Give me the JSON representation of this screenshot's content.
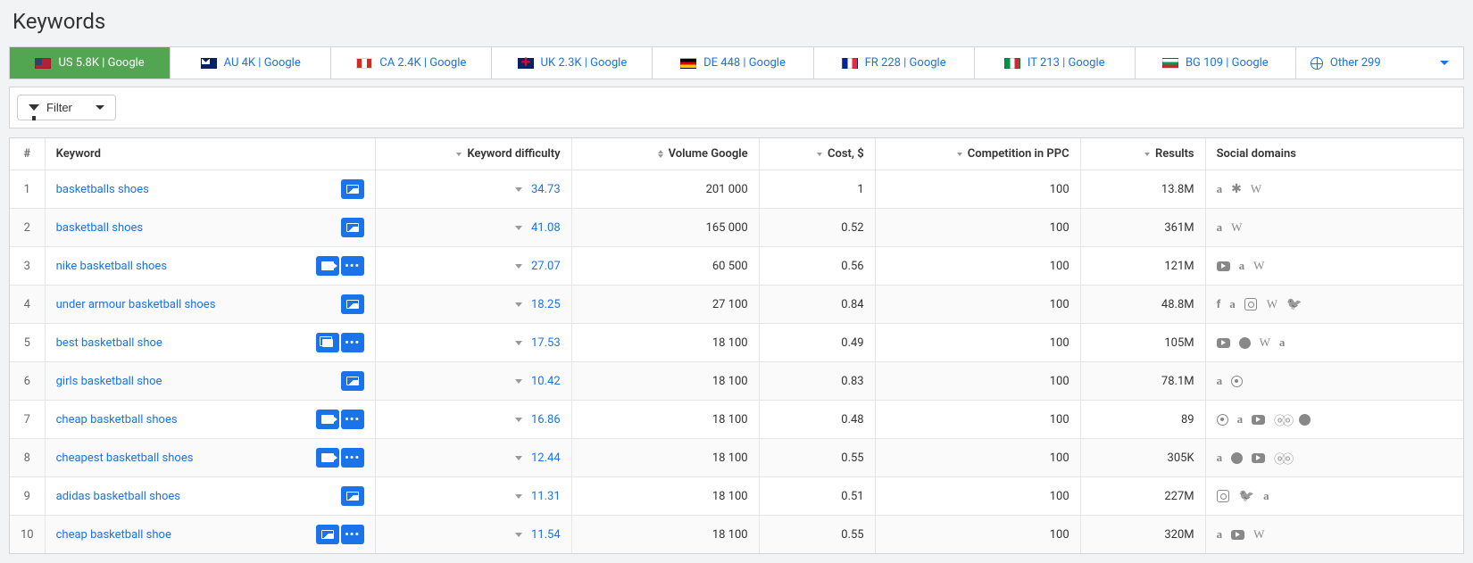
{
  "page_title": "Keywords",
  "filter_button_label": "Filter",
  "tabs": [
    {
      "label": "US 5.8K | Google",
      "flag": "us",
      "active": true
    },
    {
      "label": "AU 4K | Google",
      "flag": "au",
      "active": false
    },
    {
      "label": "CA 2.4K | Google",
      "flag": "ca",
      "active": false
    },
    {
      "label": "UK 2.3K | Google",
      "flag": "uk",
      "active": false
    },
    {
      "label": "DE 448 | Google",
      "flag": "de",
      "active": false
    },
    {
      "label": "FR 228 | Google",
      "flag": "fr",
      "active": false
    },
    {
      "label": "IT 213 | Google",
      "flag": "it",
      "active": false
    },
    {
      "label": "BG 109 | Google",
      "flag": "bg",
      "active": false
    },
    {
      "label": "Other 299",
      "flag": "globe",
      "active": false,
      "dropdown": true
    }
  ],
  "columns": {
    "num": "#",
    "keyword": "Keyword",
    "kd": "Keyword difficulty",
    "volume": "Volume Google",
    "cost": "Cost, $",
    "competition": "Competition in PPC",
    "results": "Results",
    "social": "Social domains"
  },
  "rows": [
    {
      "n": "1",
      "keyword": "basketballs shoes",
      "actions": [
        "image"
      ],
      "kd": "34.73",
      "volume": "201 000",
      "cost": "1",
      "competition": "100",
      "results": "13.8M",
      "social": [
        "amazon",
        "yelp",
        "wikipedia"
      ]
    },
    {
      "n": "2",
      "keyword": "basketball shoes",
      "actions": [
        "image"
      ],
      "kd": "41.08",
      "volume": "165 000",
      "cost": "0.52",
      "competition": "100",
      "results": "361M",
      "social": [
        "amazon",
        "wikipedia"
      ]
    },
    {
      "n": "3",
      "keyword": "nike basketball shoes",
      "actions": [
        "video",
        "more"
      ],
      "kd": "27.07",
      "volume": "60 500",
      "cost": "0.56",
      "competition": "100",
      "results": "121M",
      "social": [
        "youtube",
        "amazon",
        "wikipedia"
      ]
    },
    {
      "n": "4",
      "keyword": "under armour basketball shoes",
      "actions": [
        "image"
      ],
      "kd": "18.25",
      "volume": "27 100",
      "cost": "0.84",
      "competition": "100",
      "results": "48.8M",
      "social": [
        "facebook",
        "amazon",
        "instagram",
        "wikipedia",
        "twitter"
      ]
    },
    {
      "n": "5",
      "keyword": "best basketball shoe",
      "actions": [
        "cards",
        "more"
      ],
      "kd": "17.53",
      "volume": "18 100",
      "cost": "0.49",
      "competition": "100",
      "results": "105M",
      "social": [
        "youtube",
        "reddit",
        "wikipedia",
        "amazon"
      ]
    },
    {
      "n": "6",
      "keyword": "girls basketball shoe",
      "actions": [
        "image"
      ],
      "kd": "10.42",
      "volume": "18 100",
      "cost": "0.83",
      "competition": "100",
      "results": "78.1M",
      "social": [
        "amazon",
        "pinterest"
      ]
    },
    {
      "n": "7",
      "keyword": "cheap basketball shoes",
      "actions": [
        "video",
        "more"
      ],
      "kd": "16.86",
      "volume": "18 100",
      "cost": "0.48",
      "competition": "100",
      "results": "89",
      "social": [
        "pinterest",
        "amazon",
        "youtube",
        "tripadvisor",
        "reddit"
      ]
    },
    {
      "n": "8",
      "keyword": "cheapest basketball shoes",
      "actions": [
        "video",
        "more"
      ],
      "kd": "12.44",
      "volume": "18 100",
      "cost": "0.55",
      "competition": "100",
      "results": "305K",
      "social": [
        "amazon",
        "reddit",
        "youtube",
        "tripadvisor"
      ]
    },
    {
      "n": "9",
      "keyword": "adidas basketball shoes",
      "actions": [
        "image"
      ],
      "kd": "11.31",
      "volume": "18 100",
      "cost": "0.51",
      "competition": "100",
      "results": "227M",
      "social": [
        "instagram",
        "twitter",
        "amazon"
      ]
    },
    {
      "n": "10",
      "keyword": "cheap basketball shoe",
      "actions": [
        "image",
        "more"
      ],
      "kd": "11.54",
      "volume": "18 100",
      "cost": "0.55",
      "competition": "100",
      "results": "320M",
      "social": [
        "amazon",
        "youtube",
        "wikipedia"
      ]
    }
  ]
}
